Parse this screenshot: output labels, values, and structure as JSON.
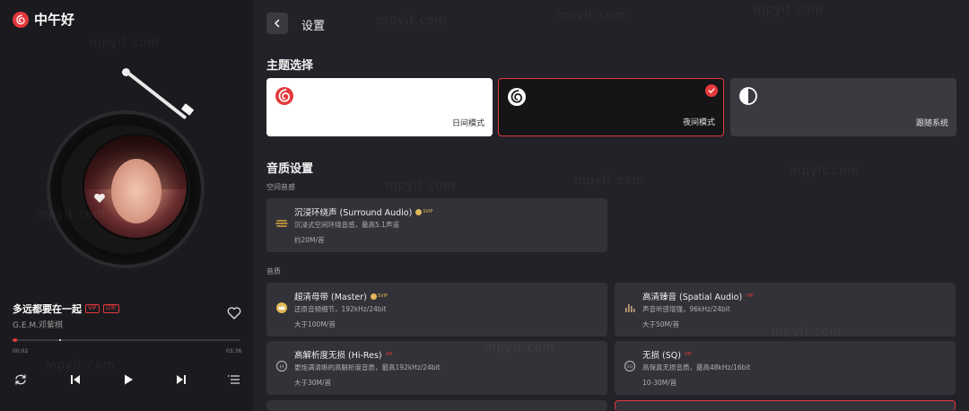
{
  "app": {
    "name": "中午好"
  },
  "player": {
    "song_title": "多远都要在一起",
    "tag_vip": "VIP",
    "tag_trial": "试听",
    "artist": "G.E.M.邓紫棋",
    "current_time": "00:02",
    "total_time": "03:36",
    "progress": 0.004
  },
  "header": {
    "title": "设置"
  },
  "theme": {
    "section_title": "主题选择",
    "options": [
      {
        "label": "日间模式",
        "selected": false
      },
      {
        "label": "夜间模式",
        "selected": true
      },
      {
        "label": "跟随系统",
        "selected": false
      }
    ]
  },
  "quality": {
    "section_title": "音质设置",
    "spatial_label": "空间音感",
    "quality_label": "音质",
    "surround": {
      "name": "沉浸环绕声 (Surround Audio)",
      "badge": "SVIP",
      "desc": "沉浸式空间环绕音感，最高5.1声道",
      "size": "约20M/首"
    },
    "items": [
      {
        "name": "超清母带 (Master)",
        "badge": "SVIP",
        "desc": "还原音频细节，192kHz/24bit",
        "size": "大于100M/首"
      },
      {
        "name": "高清臻音 (Spatial Audio)",
        "badge": "VIP",
        "desc": "声音听感增强，96kHz/24bit",
        "size": "大于50M/首"
      },
      {
        "name": "高解析度无损 (Hi-Res)",
        "badge": "VIP",
        "desc": "更饱满清晰的高解析度音质，最高192kHz/24bit",
        "size": "大于30M/首"
      },
      {
        "name": "无损 (SQ)",
        "badge": "VIP",
        "desc": "高保真无损音质，最高48kHz/16bit",
        "size": "10-30M/首"
      }
    ]
  },
  "watermark": "mpyit.com",
  "colors": {
    "accent": "#e4393c",
    "gold": "#e2b758",
    "panel": "#1b1b1f",
    "card": "#323238"
  }
}
